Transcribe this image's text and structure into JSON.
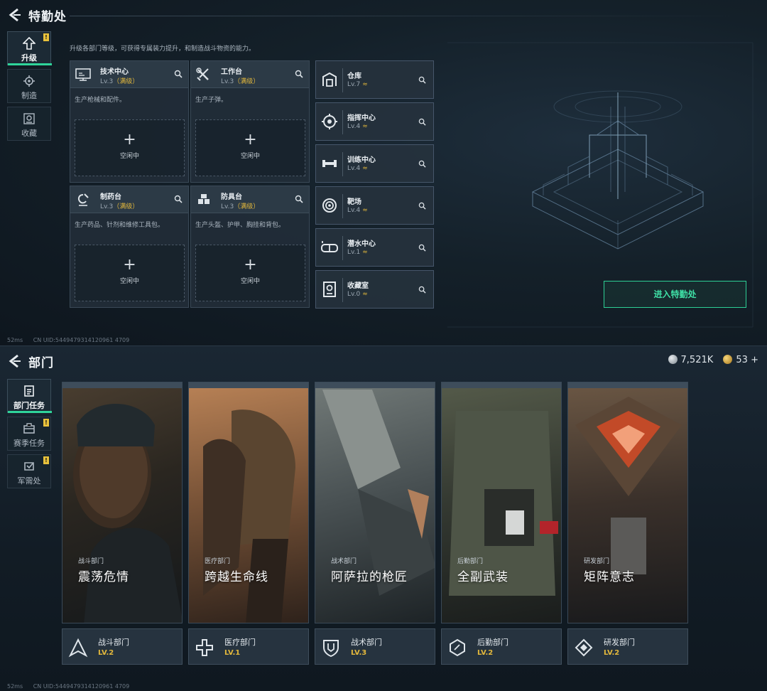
{
  "upper": {
    "title": "特勤处",
    "description": "升级各部门等级，可获得专属装力提升，和制造战斗物资的能力。",
    "tabs": [
      {
        "label": "升级",
        "icon": "upgrade-icon",
        "active": true,
        "badge": "!"
      },
      {
        "label": "制造",
        "icon": "craft-icon",
        "active": false
      },
      {
        "label": "收藏",
        "icon": "collection-icon",
        "active": false
      }
    ],
    "workshops": [
      {
        "name": "技术中心",
        "level": "Lv.3",
        "max": "（满级）",
        "desc": "生产枪械和配件。",
        "slot_plus": "+",
        "slot_status": "空闲中",
        "icon": "computer-icon"
      },
      {
        "name": "工作台",
        "level": "Lv.3",
        "max": "（满级）",
        "desc": "生产子弹。",
        "slot_plus": "+",
        "slot_status": "空闲中",
        "icon": "tools-icon"
      },
      {
        "name": "制药台",
        "level": "Lv.3",
        "max": "（满级）",
        "desc": "生产药品、针剂和维修工具包。",
        "slot_plus": "+",
        "slot_status": "空闲中",
        "icon": "pharmacy-icon"
      },
      {
        "name": "防具台",
        "level": "Lv.3",
        "max": "（满级）",
        "desc": "生产头盔、护甲、胸挂和背包。",
        "slot_plus": "+",
        "slot_status": "空闲中",
        "icon": "armor-icon"
      }
    ],
    "facilities": [
      {
        "name": "仓库",
        "level": "Lv.7",
        "upgrade": "≈",
        "icon": "warehouse-icon"
      },
      {
        "name": "指挥中心",
        "level": "Lv.4",
        "upgrade": "≈",
        "icon": "command-center-icon"
      },
      {
        "name": "训练中心",
        "level": "Lv.4",
        "upgrade": "≈",
        "icon": "dumbbell-icon"
      },
      {
        "name": "靶场",
        "level": "Lv.4",
        "upgrade": "≈",
        "icon": "target-icon"
      },
      {
        "name": "潜水中心",
        "level": "Lv.1",
        "upgrade": "≈",
        "icon": "diving-mask-icon"
      },
      {
        "name": "收藏室",
        "level": "Lv.0",
        "upgrade": "≈",
        "icon": "collection-room-icon"
      }
    ],
    "enter_button": "进入特勤处",
    "status": {
      "ping": "52ms",
      "uid": "CN UID:5449479314120961 4709"
    }
  },
  "lower": {
    "title": "部门",
    "currency": {
      "silver": "7,521K",
      "gold": "53"
    },
    "currency_add": "+",
    "tabs": [
      {
        "label": "部门任务",
        "icon": "department-tasks-icon",
        "active": true
      },
      {
        "label": "赛季任务",
        "icon": "season-tasks-icon",
        "active": false,
        "badge": "!"
      },
      {
        "label": "军需处",
        "icon": "quartermaster-icon",
        "active": false,
        "badge": "!"
      }
    ],
    "departments": [
      {
        "sub": "战斗部门",
        "title": "震荡危情",
        "name": "战斗部门",
        "level": "LV.2",
        "icon": "combat-dept-icon",
        "bg": "#3a3328",
        "bg2": "#151a1e"
      },
      {
        "sub": "医疗部门",
        "title": "跨越生命线",
        "name": "医疗部门",
        "level": "LV.1",
        "icon": "medical-dept-icon",
        "bg": "#9a6a45",
        "bg2": "#3a2a20"
      },
      {
        "sub": "战术部门",
        "title": "阿萨拉的枪匠",
        "name": "战术部门",
        "level": "LV.3",
        "icon": "tactical-dept-icon",
        "bg": "#56605f",
        "bg2": "#262c2f"
      },
      {
        "sub": "后勤部门",
        "title": "全副武装",
        "name": "后勤部门",
        "level": "LV.2",
        "icon": "logistics-dept-icon",
        "bg": "#4a5040",
        "bg2": "#1e2220"
      },
      {
        "sub": "研发部门",
        "title": "矩阵意志",
        "name": "研发部门",
        "level": "LV.2",
        "icon": "research-dept-icon",
        "bg": "#5a4a3c",
        "bg2": "#1e1d1e"
      }
    ],
    "status": {
      "ping": "52ms",
      "uid": "CN UID:5449479314120961 4709"
    }
  }
}
